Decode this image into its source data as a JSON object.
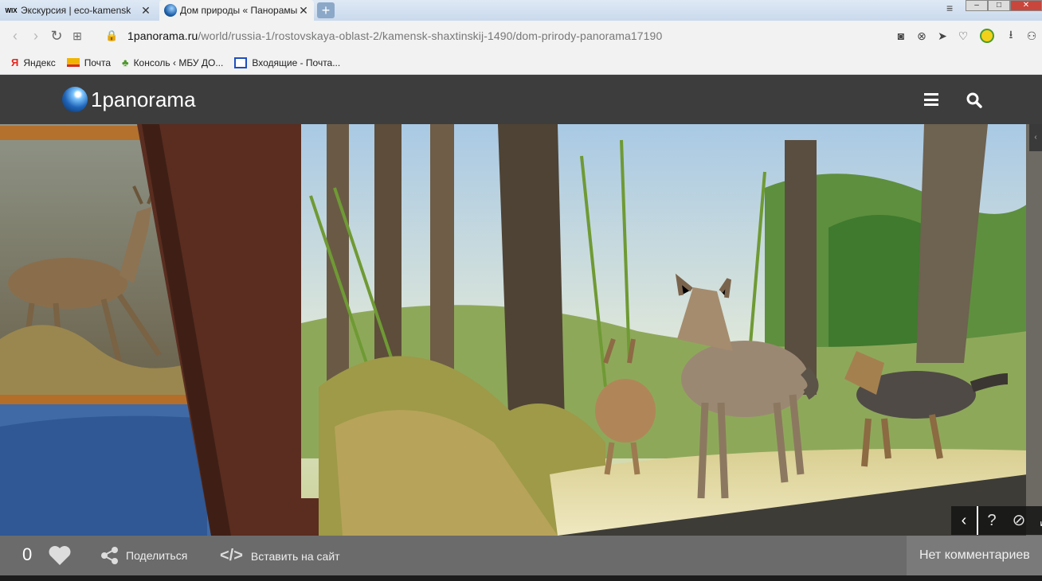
{
  "browser": {
    "tabs": [
      {
        "title": "Экскурсия | eco-kamensk",
        "favicon": "wix-icon",
        "active": false
      },
      {
        "title": "Дом природы « Панорамы",
        "favicon": "panorama-globe-icon",
        "active": true
      }
    ],
    "new_tab_label": "+",
    "address": {
      "host": "1panorama.ru",
      "path": "/world/russia-1/rostovskaya-oblast-2/kamensk-shaxtinskij-1490/dom-prirody-panorama17190"
    },
    "bookmarks": [
      {
        "label": "Яндекс",
        "icon": "yandex-icon"
      },
      {
        "label": "Почта",
        "icon": "mail-icon"
      },
      {
        "label": "Консоль ‹ МБУ ДО...",
        "icon": "tree-icon"
      },
      {
        "label": "Входящие - Почта...",
        "icon": "inbox-icon"
      }
    ]
  },
  "site": {
    "logo_text": "1panorama"
  },
  "viewer": {
    "controls": {
      "back": "‹",
      "help": "?",
      "hide": "⊘",
      "fullscreen": "⤢"
    }
  },
  "toolbar": {
    "likes_count": "0",
    "share_label": "Поделиться",
    "embed_label": "Вставить на сайт",
    "comments_label": "Нет комментариев"
  },
  "colors": {
    "header_bg": "#3d3d3d",
    "bottom_bar_bg": "#6b6b6b",
    "secure_lock": "#27a13a"
  }
}
